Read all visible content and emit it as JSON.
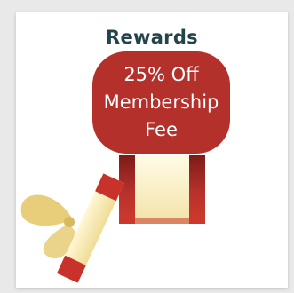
{
  "rewards": {
    "title": "Rewards",
    "offer": {
      "line1": "25% Off",
      "line2": "Membership",
      "line3": "Fee"
    }
  },
  "colors": {
    "accent_red": "#b3302b",
    "title_text": "#24444c",
    "ribbon_gold": "#e8cd7a"
  }
}
